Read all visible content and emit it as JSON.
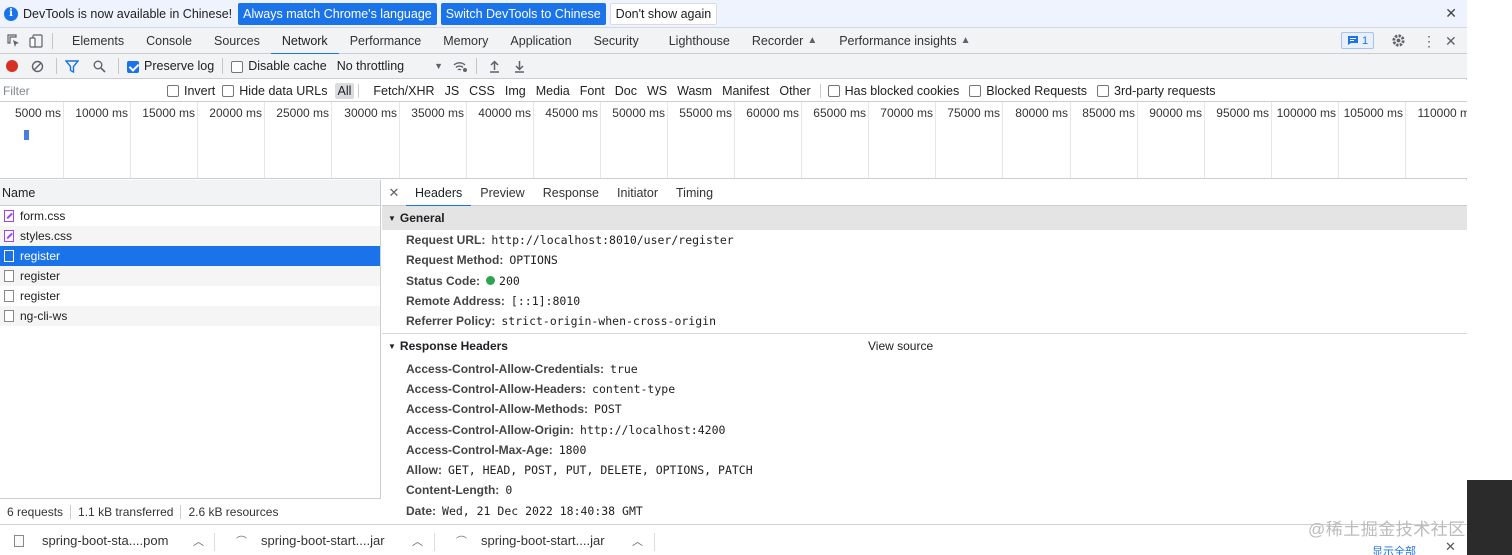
{
  "infobar": {
    "message": "DevTools is now available in Chinese!",
    "btn_match": "Always match Chrome's language",
    "btn_switch": "Switch DevTools to Chinese",
    "btn_dismiss": "Don't show again",
    "close": "✕"
  },
  "tabs": {
    "elements": "Elements",
    "console": "Console",
    "sources": "Sources",
    "network": "Network",
    "performance": "Performance",
    "memory": "Memory",
    "application": "Application",
    "security": "Security",
    "lighthouse": "Lighthouse",
    "recorder": "Recorder",
    "performance_insights": "Performance insights",
    "issues_count": "1"
  },
  "toolbar": {
    "preserve_log": "Preserve log",
    "disable_cache": "Disable cache",
    "throttling": "No throttling"
  },
  "filterbar": {
    "filter_placeholder": "Filter",
    "invert": "Invert",
    "hide_data_urls": "Hide data URLs",
    "types": [
      "All",
      "Fetch/XHR",
      "JS",
      "CSS",
      "Img",
      "Media",
      "Font",
      "Doc",
      "WS",
      "Wasm",
      "Manifest",
      "Other"
    ],
    "has_blocked_cookies": "Has blocked cookies",
    "blocked_requests": "Blocked Requests",
    "third_party": "3rd-party requests"
  },
  "overview": {
    "ticks": [
      "5000 ms",
      "10000 ms",
      "15000 ms",
      "20000 ms",
      "25000 ms",
      "30000 ms",
      "35000 ms",
      "40000 ms",
      "45000 ms",
      "50000 ms",
      "55000 ms",
      "60000 ms",
      "65000 ms",
      "70000 ms",
      "75000 ms",
      "80000 ms",
      "85000 ms",
      "90000 ms",
      "95000 ms",
      "100000 ms",
      "105000 ms",
      "110000 m"
    ]
  },
  "requests": {
    "header": "Name",
    "rows": [
      "form.css",
      "styles.css",
      "register",
      "register",
      "register",
      "ng-cli-ws"
    ],
    "summary": {
      "count": "6 requests",
      "transferred": "1.1 kB transferred",
      "resources": "2.6 kB resources"
    }
  },
  "details": {
    "tabs": [
      "Headers",
      "Preview",
      "Response",
      "Initiator",
      "Timing"
    ],
    "general_title": "General",
    "general": [
      {
        "name": "Request URL:",
        "value": "http://localhost:8010/user/register"
      },
      {
        "name": "Request Method:",
        "value": "OPTIONS"
      },
      {
        "name": "Status Code:",
        "value": "200"
      },
      {
        "name": "Remote Address:",
        "value": "[::1]:8010"
      },
      {
        "name": "Referrer Policy:",
        "value": "strict-origin-when-cross-origin"
      }
    ],
    "response_title": "Response Headers",
    "view_source": "View source",
    "response": [
      {
        "name": "Access-Control-Allow-Credentials:",
        "value": "true"
      },
      {
        "name": "Access-Control-Allow-Headers:",
        "value": "content-type"
      },
      {
        "name": "Access-Control-Allow-Methods:",
        "value": "POST"
      },
      {
        "name": "Access-Control-Allow-Origin:",
        "value": "http://localhost:4200"
      },
      {
        "name": "Access-Control-Max-Age:",
        "value": "1800"
      },
      {
        "name": "Allow:",
        "value": "GET, HEAD, POST, PUT, DELETE, OPTIONS, PATCH"
      },
      {
        "name": "Content-Length:",
        "value": "0"
      },
      {
        "name": "Date:",
        "value": "Wed, 21 Dec 2022 18:40:38 GMT"
      }
    ]
  },
  "downloads": {
    "items": [
      "spring-boot-sta....pom",
      "spring-boot-start....jar",
      "spring-boot-start....jar"
    ],
    "show_all": "显示全部",
    "watermark": "@稀土掘金技术社区"
  }
}
